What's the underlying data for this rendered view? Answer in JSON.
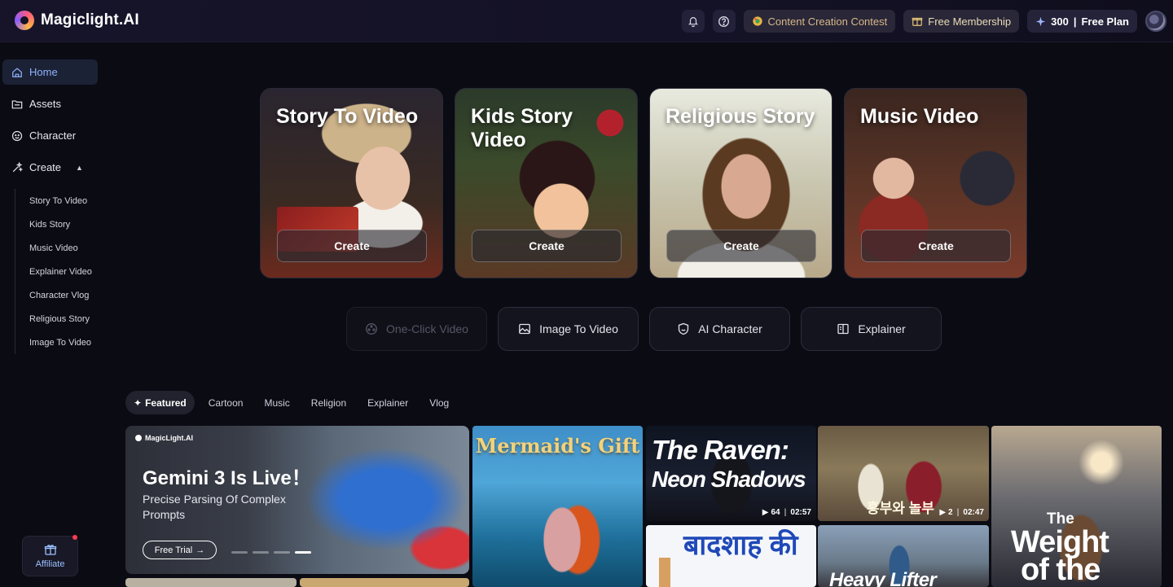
{
  "app": {
    "name": "Magiclight.AI"
  },
  "header": {
    "contest_label": "Content Creation Contest",
    "membership_label": "Free Membership",
    "credits": "300",
    "plan_label": "Free Plan",
    "separator": "|"
  },
  "sidebar": {
    "items": [
      {
        "label": "Home",
        "icon": "home-icon"
      },
      {
        "label": "Assets",
        "icon": "folder-icon"
      },
      {
        "label": "Character",
        "icon": "character-icon"
      },
      {
        "label": "Create",
        "icon": "magic-wand-icon"
      }
    ],
    "create_sub_items": [
      "Story To Video",
      "Kids Story",
      "Music Video",
      "Explainer Video",
      "Character Vlog",
      "Religious Story",
      "Image To Video"
    ],
    "affiliate_label": "Affiliate"
  },
  "hero_cards": [
    {
      "title": "Story To Video",
      "button": "Create"
    },
    {
      "title": "Kids Story Video",
      "button": "Create"
    },
    {
      "title": "Religious Story",
      "button": "Create"
    },
    {
      "title": "Music Video",
      "button": "Create"
    }
  ],
  "tools": [
    {
      "label": "One-Click Video",
      "disabled": true
    },
    {
      "label": "Image To Video"
    },
    {
      "label": "AI Character"
    },
    {
      "label": "Explainer"
    }
  ],
  "tabs": [
    "Featured",
    "Cartoon",
    "Music",
    "Religion",
    "Explainer",
    "Vlog"
  ],
  "banner": {
    "brand": "MagicLight.AI",
    "title": "Gemini 3 Is Live！",
    "subtitle": "Precise Parsing Of Complex Prompts",
    "button": "Free Trial",
    "button_arrow": "→"
  },
  "gallery": {
    "mermaid_title": "Mermaid's Gift",
    "raven_title_1": "The Raven:",
    "raven_title_2": "Neon Shadows",
    "raven_count": "64",
    "raven_duration": "02:57",
    "korean_title": "흥부와 놀부",
    "korean_count": "2",
    "korean_duration": "02:47",
    "cross_l1": "The",
    "cross_l2": "Weight",
    "cross_l3": "of the",
    "hindi_title": "बादशाह की",
    "heavy_title": "Heavy Lifter"
  },
  "colors": {
    "accent": "#8fb2ff",
    "contest": "#d7b98a",
    "background": "#0b0b14"
  }
}
